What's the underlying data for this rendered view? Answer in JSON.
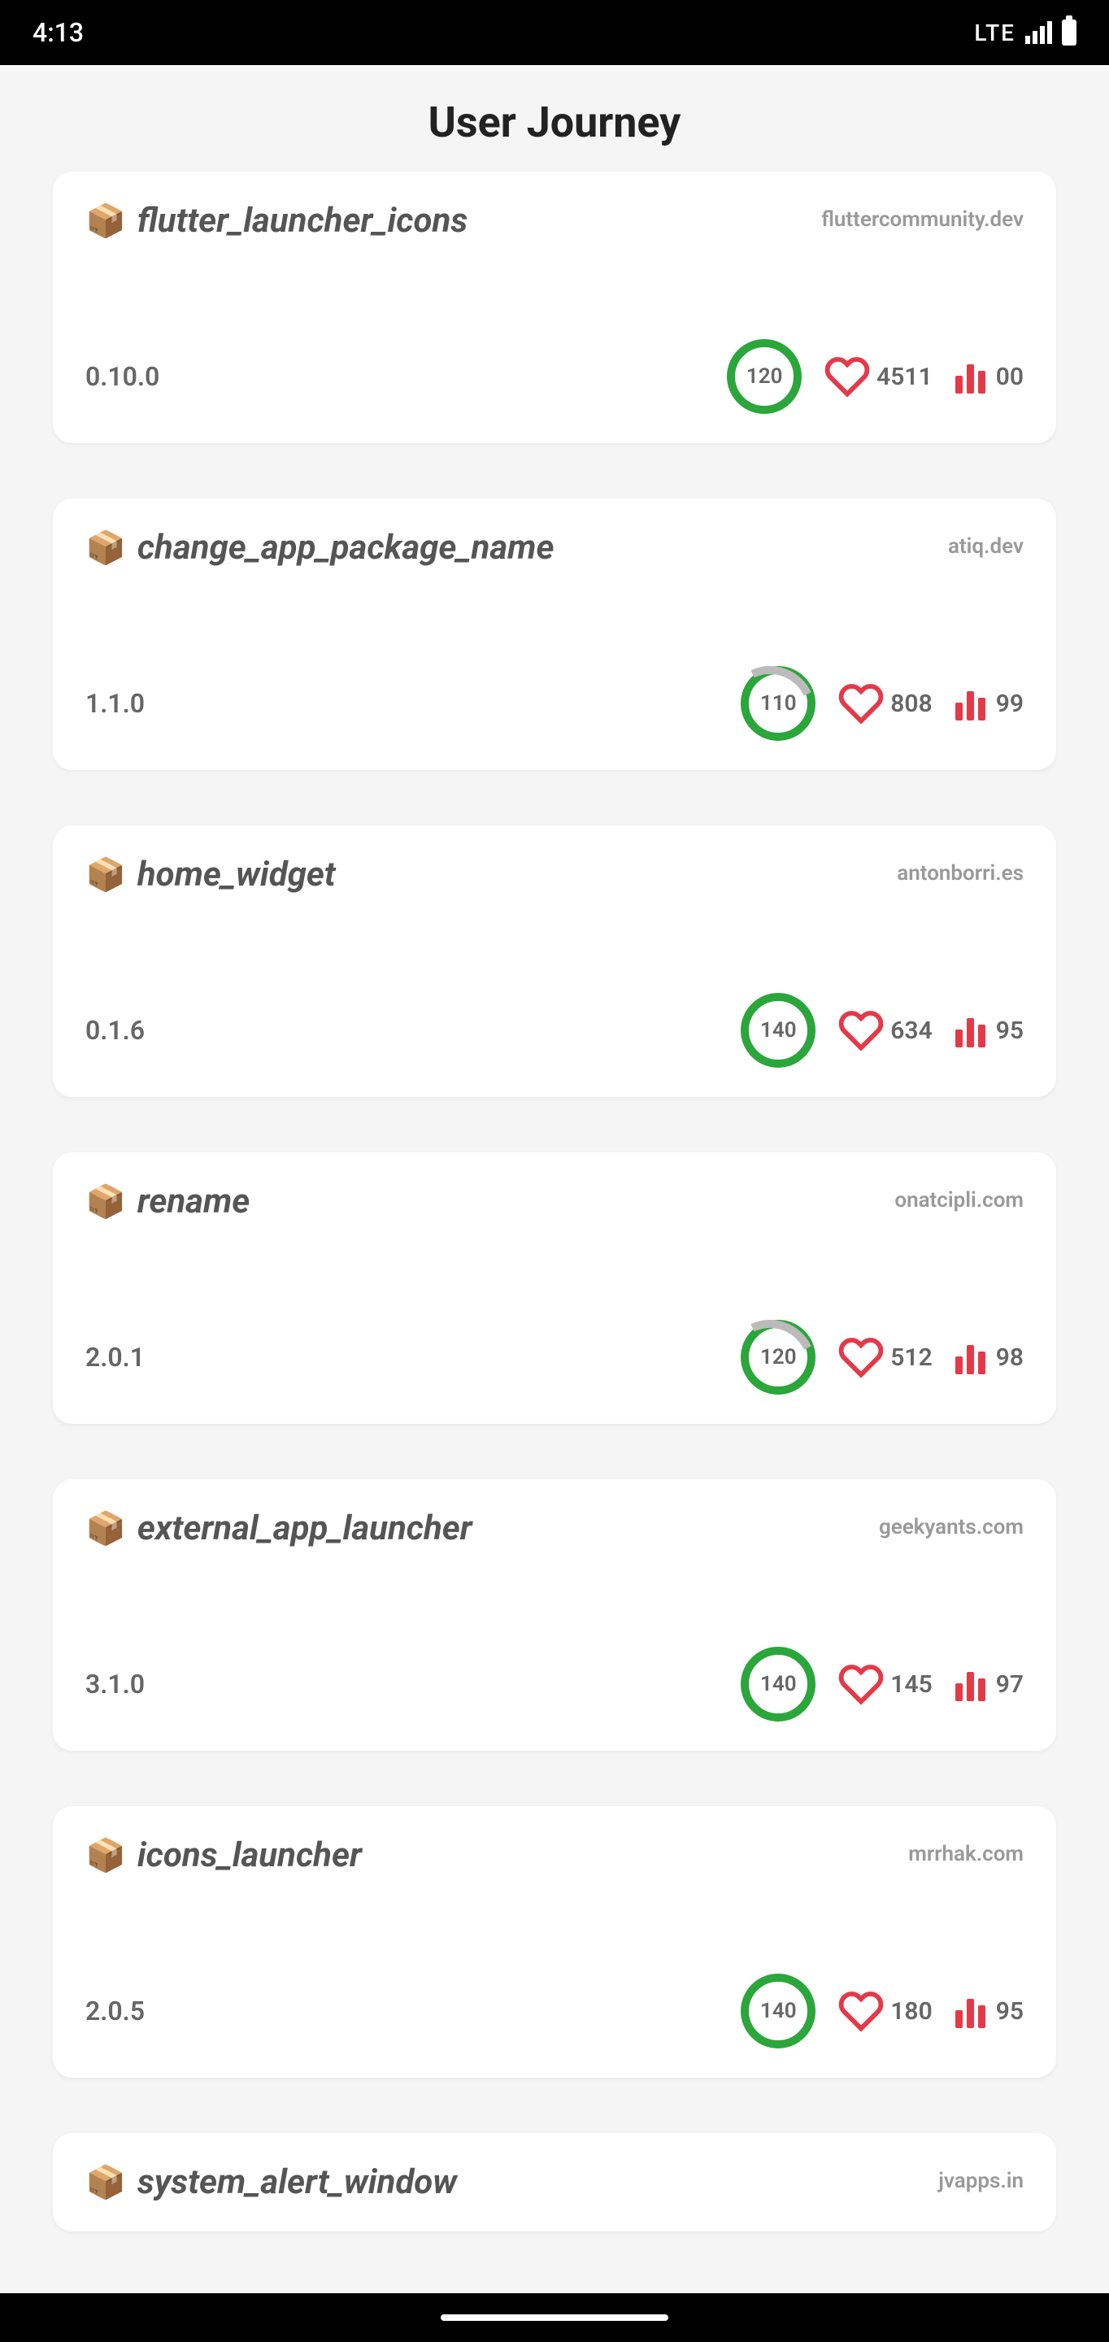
{
  "status_bar": {
    "time": "4:13",
    "network": "LTE"
  },
  "page_title": "User Journey",
  "packages": [
    {
      "name": "flutter_launcher_icons",
      "publisher": "fluttercommunity.dev",
      "version": "0.10.0",
      "score": "120",
      "likes": "4511",
      "popularity": "00",
      "score_partial": false,
      "heart_filled": false
    },
    {
      "name": "change_app_package_name",
      "publisher": "atiq.dev",
      "version": "1.1.0",
      "score": "110",
      "likes": "808",
      "popularity": "99",
      "score_partial": true,
      "heart_filled": true
    },
    {
      "name": "home_widget",
      "publisher": "antonborri.es",
      "version": "0.1.6",
      "score": "140",
      "likes": "634",
      "popularity": "95",
      "score_partial": false,
      "heart_filled": true
    },
    {
      "name": "rename",
      "publisher": "onatcipli.com",
      "version": "2.0.1",
      "score": "120",
      "likes": "512",
      "popularity": "98",
      "score_partial": true,
      "heart_filled": true
    },
    {
      "name": "external_app_launcher",
      "publisher": "geekyants.com",
      "version": "3.1.0",
      "score": "140",
      "likes": "145",
      "popularity": "97",
      "score_partial": false,
      "heart_filled": true
    },
    {
      "name": "icons_launcher",
      "publisher": "mrrhak.com",
      "version": "2.0.5",
      "score": "140",
      "likes": "180",
      "popularity": "95",
      "score_partial": false,
      "heart_filled": true
    },
    {
      "name": "system_alert_window",
      "publisher": "jvapps.in",
      "version": "",
      "score": "",
      "likes": "",
      "popularity": "",
      "score_partial": false,
      "heart_filled": false
    }
  ]
}
